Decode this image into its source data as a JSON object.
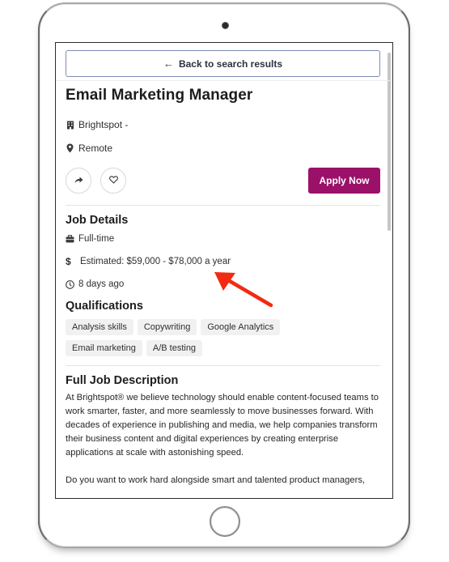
{
  "navigation": {
    "back_label": "Back to search results",
    "back_icon": "arrow-left-icon"
  },
  "job": {
    "title": "Email Marketing Manager",
    "company": "Brightspot -",
    "company_icon": "building-icon",
    "location": "Remote",
    "location_icon": "map-pin-icon"
  },
  "actions": {
    "share_icon": "share-icon",
    "save_icon": "heart-icon",
    "apply_label": "Apply Now"
  },
  "job_details": {
    "heading": "Job Details",
    "job_type": "Full-time",
    "job_type_icon": "briefcase-icon",
    "salary_symbol": "$",
    "salary": "Estimated: $59,000 - $78,000 a year",
    "posted": "8 days ago",
    "posted_icon": "clock-icon"
  },
  "qualifications": {
    "heading": "Qualifications",
    "tags": [
      "Analysis skills",
      "Copywriting",
      "Google Analytics",
      "Email marketing",
      "A/B testing"
    ]
  },
  "description": {
    "heading": "Full Job Description",
    "paragraphs": [
      "At Brightspot® we believe technology should enable content-focused teams to work smarter, faster, and more seamlessly to move businesses forward. With decades of experience in publishing and media, we help companies transform their business content and digital experiences by creating enterprise applications at scale with astonishing speed.",
      "Do you want to work hard alongside smart and talented product managers,"
    ]
  },
  "colors": {
    "apply_button": "#9b1169",
    "back_button_border": "#7c8cb5",
    "annotation_arrow": "#f22a12"
  }
}
